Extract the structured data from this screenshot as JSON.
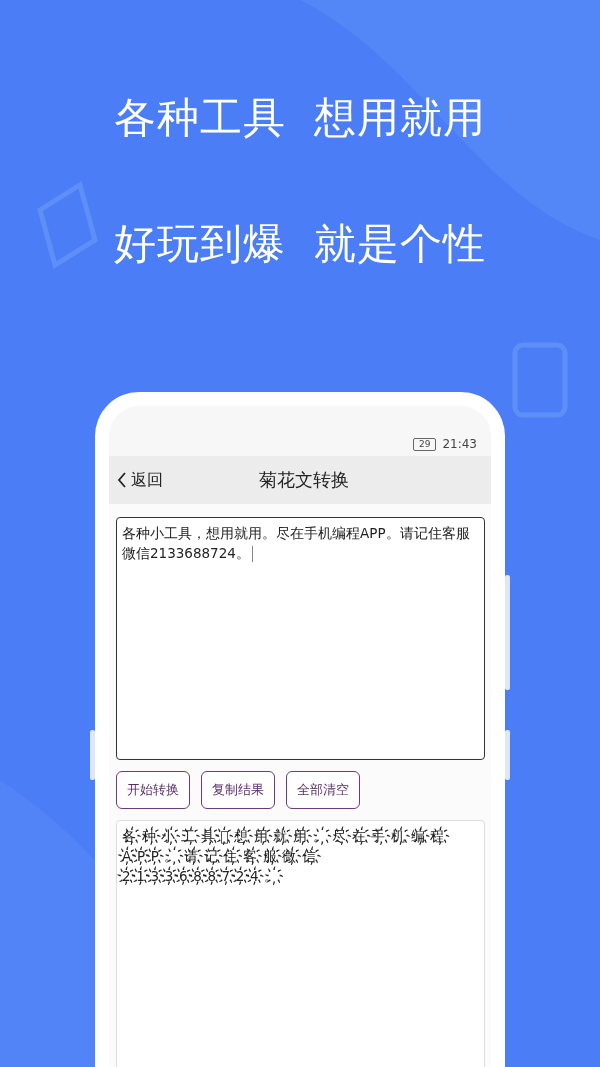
{
  "headline": [
    "各种工具  想用就用",
    "好玩到爆  就是个性"
  ],
  "status_bar": {
    "battery": "29",
    "time": "21:43"
  },
  "nav": {
    "back": "返回",
    "title": "菊花文转换"
  },
  "input": {
    "value": "各种小工具，想用就用。尽在手机编程APP。请记住客服微信2133688724。"
  },
  "buttons": [
    "开始转换",
    "复制结果",
    "全部清空"
  ],
  "output": {
    "value": "各҉种҉小҉工҉具҉，҉想҉用҉就҉用҉。҉尽҉在҉手҉机҉编҉程҉A҉P҉P҉。҉请҉记҉住҉客҉服҉微҉信҉2҉1҉3҉3҉6҉8҉8҉7҉2҉4҉。҉"
  }
}
